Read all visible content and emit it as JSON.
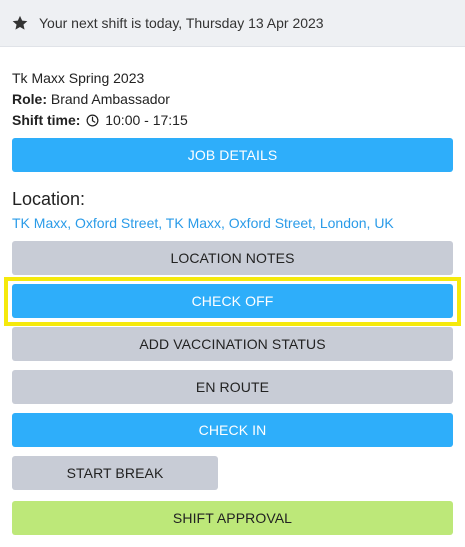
{
  "banner": {
    "icon": "star-icon",
    "text": "Your next shift is today, Thursday 13 Apr 2023"
  },
  "shift": {
    "name": "Tk Maxx Spring 2023",
    "role_label": "Role:",
    "role_value": "Brand Ambassador",
    "time_label": "Shift time:",
    "time_icon": "clock-icon",
    "time_value": "10:00 - 17:15"
  },
  "buttons": {
    "job_details": "JOB DETAILS",
    "location_notes": "LOCATION NOTES",
    "check_off": "CHECK OFF",
    "add_vaccination_status": "ADD VACCINATION STATUS",
    "en_route": "EN ROUTE",
    "check_in": "CHECK IN",
    "start_break": "START BREAK",
    "shift_approval": "SHIFT APPROVAL"
  },
  "location": {
    "heading": "Location:",
    "address": "TK Maxx, Oxford Street, TK Maxx, Oxford Street, London, UK"
  },
  "colors": {
    "primary_blue": "#2eaefa",
    "neutral_grey": "#c8ccd6",
    "approval_green": "#bde879",
    "highlight_yellow": "#f5e90c",
    "link_blue": "#2a9be8"
  }
}
